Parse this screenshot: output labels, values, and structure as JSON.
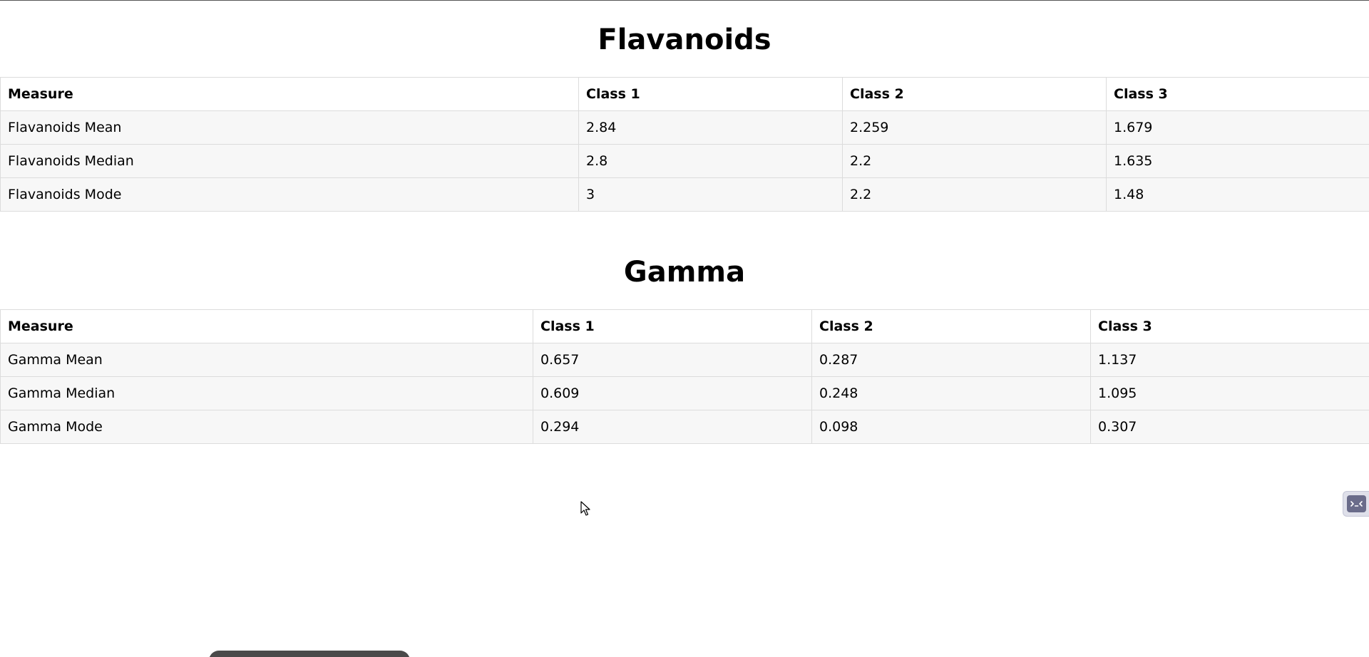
{
  "sections": [
    {
      "title": "Flavanoids",
      "headers": [
        "Measure",
        "Class 1",
        "Class 2",
        "Class 3"
      ],
      "rows": [
        [
          "Flavanoids Mean",
          "2.84",
          "2.259",
          "1.679"
        ],
        [
          "Flavanoids Median",
          "2.8",
          "2.2",
          "1.635"
        ],
        [
          "Flavanoids Mode",
          "3",
          "2.2",
          "1.48"
        ]
      ]
    },
    {
      "title": "Gamma",
      "headers": [
        "Measure",
        "Class 1",
        "Class 2",
        "Class 3"
      ],
      "rows": [
        [
          "Gamma Mean",
          "0.657",
          "0.287",
          "1.137"
        ],
        [
          "Gamma Median",
          "0.609",
          "0.248",
          "1.095"
        ],
        [
          "Gamma Mode",
          "0.294",
          "0.098",
          "0.307"
        ]
      ]
    }
  ],
  "icons": {
    "cursor": "mouse-pointer-icon",
    "side_widget": "terminal-icon"
  }
}
